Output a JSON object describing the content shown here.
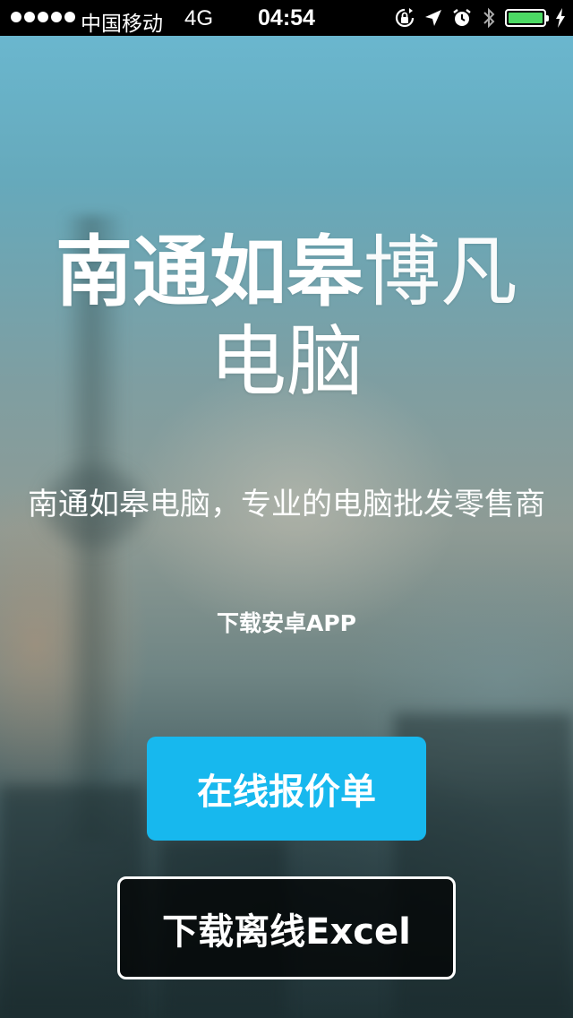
{
  "status_bar": {
    "carrier": "中国移动",
    "network": "4G",
    "time": "04:54",
    "signal_bars": 5,
    "battery_color": "#4cd964",
    "icons": [
      "signal-dots-icon",
      "rotation-lock-icon",
      "location-arrow-icon",
      "alarm-icon",
      "bluetooth-icon",
      "battery-icon",
      "charging-bolt-icon"
    ]
  },
  "hero": {
    "title_bold": "南通如皋",
    "title_light": "博凡",
    "title_line2": "电脑",
    "subtitle": "南通如皋电脑，专业的电脑批发零售商",
    "download_app_label": "下载安卓APP"
  },
  "buttons": {
    "online_quote_label": "在线报价单",
    "download_excel_label": "下载离线Excel"
  },
  "colors": {
    "accent": "#17b8ee",
    "excel_button_bg": "#000000"
  }
}
